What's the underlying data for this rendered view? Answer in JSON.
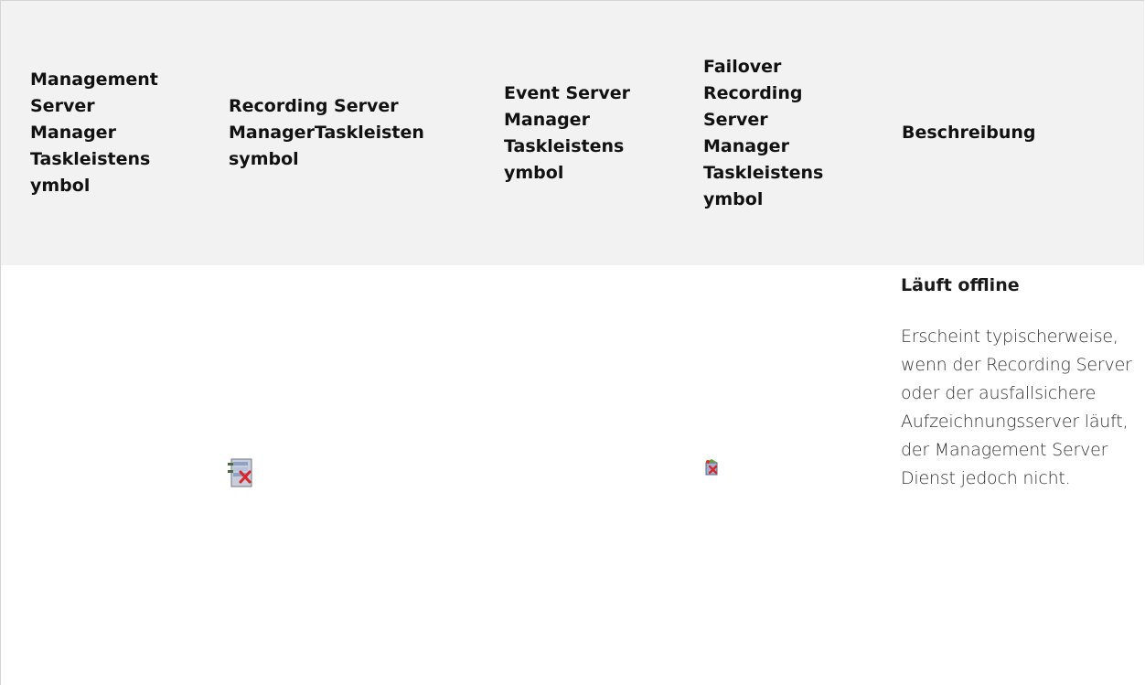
{
  "table": {
    "headers": {
      "management": "Management Server Manager Taskleistensymbol",
      "recording": "Recording Server ManagerTaskleistensymbol",
      "event": "Event Server Manager Taskleistensymbol",
      "failover": "Failover Recording Server Manager Taskleistensymbol",
      "description": "Beschreibung"
    },
    "header_lines": {
      "management": [
        "Management",
        "Server",
        "Manager",
        "Taskleistens",
        "ymbol"
      ],
      "recording": [
        "Recording Server",
        "ManagerTaskleisten",
        "symbol"
      ],
      "event": [
        "Event Server",
        "Manager",
        "Taskleistens",
        "ymbol"
      ],
      "failover": [
        "Failover",
        "Recording",
        "Server",
        "Manager",
        "Taskleistens",
        "ymbol"
      ]
    },
    "rows": [
      {
        "management_icon": "",
        "recording_icon": "recording-server-offline-icon",
        "event_icon": "",
        "failover_icon": "failover-server-offline-icon",
        "description_title": "Läuft offline",
        "description_text": "Erscheint typischerweise, wenn der Recording Server oder der ausfallsichere Aufzeichnungsserver läuft, der Management Server Dienst jedoch nicht."
      }
    ]
  },
  "colors": {
    "header_bg": "#f2f2f2",
    "border": "#d4d4d4",
    "text": "#1a1a1a"
  }
}
